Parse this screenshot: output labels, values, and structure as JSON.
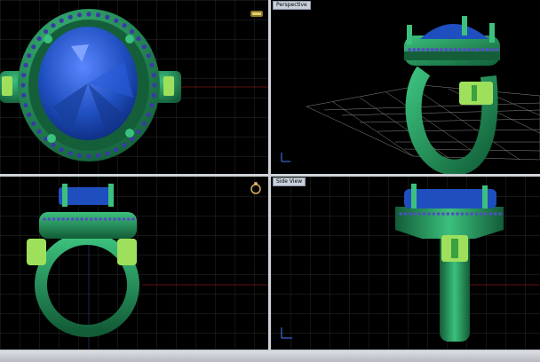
{
  "viewports": [
    {
      "id": "top",
      "label": ""
    },
    {
      "id": "perspective",
      "label": "Perspective"
    },
    {
      "id": "front",
      "label": ""
    },
    {
      "id": "side",
      "label": "Side View"
    }
  ],
  "colors": {
    "background": "#000000",
    "grid": "#3a3a3a",
    "grid_major": "#5a5a5a",
    "metal": "#1f8a55",
    "metal_light": "#3cc07d",
    "accent_metal": "#9ee05c",
    "gem": "#1f4fbf",
    "gem_light": "#5a86ff",
    "accent_red": "#c02020",
    "divider": "#cfd3d8"
  },
  "icons": {
    "view_gizmo": "axis-gizmo-icon",
    "ring_preview": "ring-preview-icon"
  }
}
